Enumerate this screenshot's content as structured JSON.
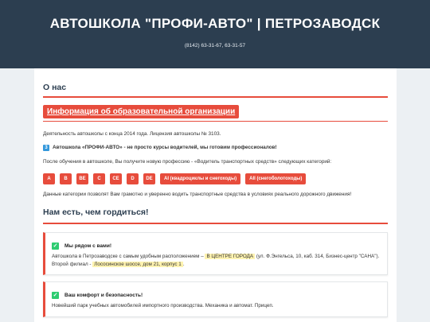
{
  "header": {
    "title": "АВТОШКОЛА \"ПРОФИ-АВТО\" | ПЕТРОЗАВОДСК",
    "phones": "(8142) 63-31-67, 63-31-57"
  },
  "about": {
    "title": "О нас",
    "info_link": "Информация об образовательной организации",
    "line1": "Деятельность автошколы с конца 2014 года. Лицензия автошколы № 3103.",
    "line2_icon": "3",
    "line2": "Автошкола «ПРОФИ-АВТО» - не просто курсы водителей, мы готовим профессионалов!",
    "line3": "После обучения в автошколе, Вы получите новую профессию - «Водитель транспортных средств» следующих категорий:",
    "categories": [
      "A",
      "B",
      "BE",
      "C",
      "CE",
      "D",
      "DE",
      "AI (квадроциклы и снегоходы)",
      "AII (снегоболотоходы)"
    ],
    "line4": "Данные категории позволят Вам грамотно и уверенно водить транспортные средства в условиях реального дорожного движения!"
  },
  "pride": {
    "title": "Нам есть, чем гордиться!",
    "card1": {
      "title": "Мы рядом с вами!",
      "text_before": "Автошкола в Петрозаводске с самым удобным расположением –",
      "highlight1": "В ЦЕНТРЕ ГОРОДА",
      "text_middle": "(ул. Ф.Энгельса, 10, каб. 314, Бизнес-центр \"САНА\"). Второй филиал -",
      "highlight2": "Лососинское шоссе, дом 21, корпус 1",
      "text_after": "."
    },
    "card2": {
      "title": "Ваш комфорт и безопасность!",
      "text": "Новейший парк учебных автомобилей импортного производства. Механика и автомат. Прицеп."
    }
  },
  "colors": {
    "header_bg": "#2c3e50",
    "accent": "#e74c3c",
    "check": "#2ecc71"
  }
}
